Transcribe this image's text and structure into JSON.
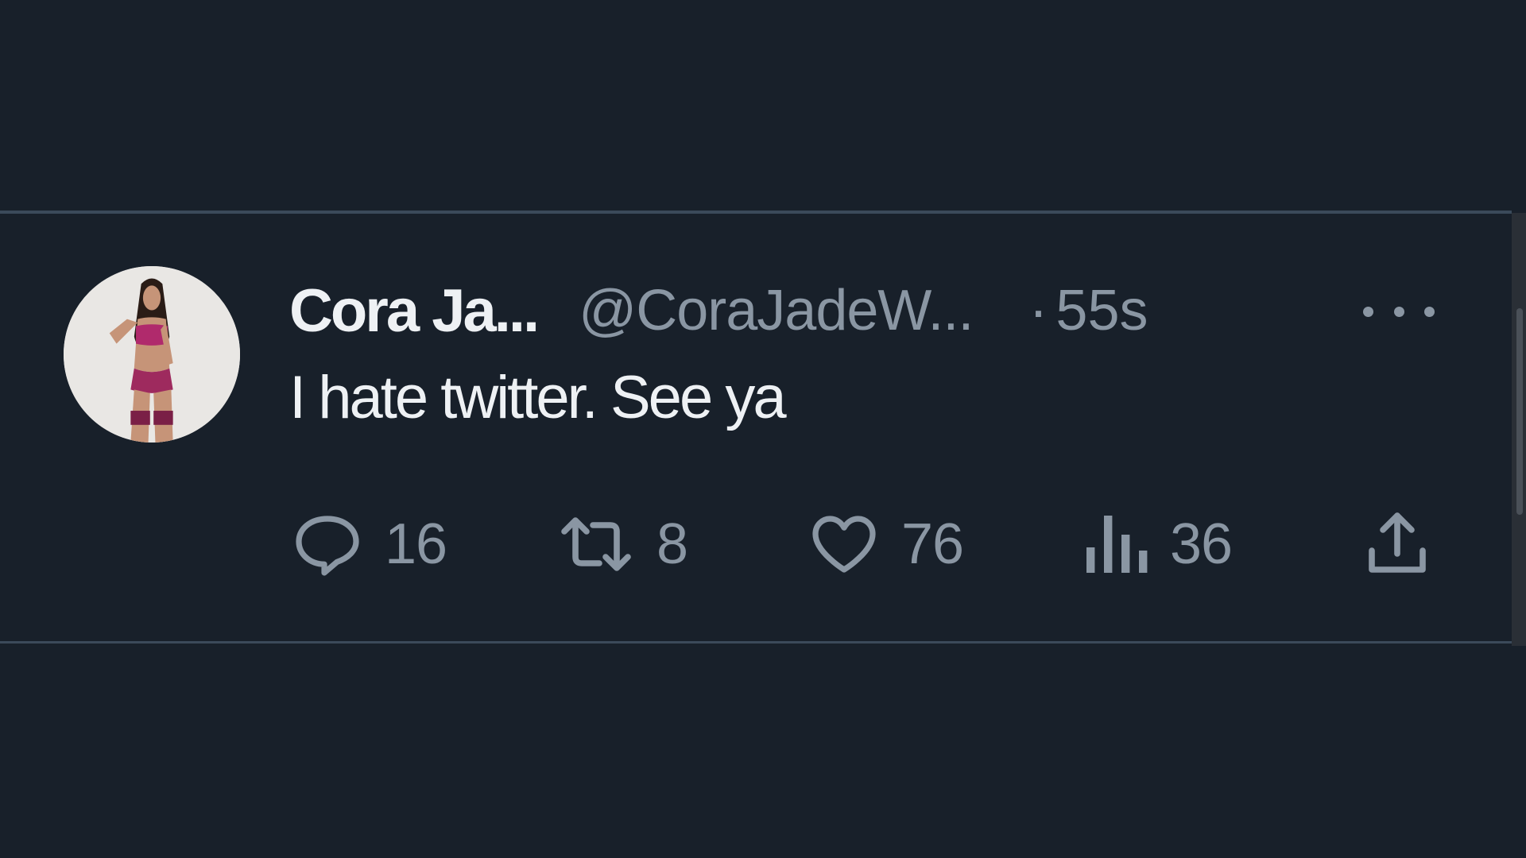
{
  "tweet": {
    "display_name": "Cora Ja...",
    "handle": "@CoraJadeW...",
    "separator": "·",
    "time": "55s",
    "text": "I hate twitter. See ya"
  },
  "actions": {
    "reply_count": "16",
    "retweet_count": "8",
    "like_count": "76",
    "views_count": "36"
  },
  "icons": {
    "more": "more-icon",
    "reply": "reply-icon",
    "retweet": "retweet-icon",
    "like": "heart-icon",
    "views": "views-icon",
    "share": "share-icon"
  },
  "colors": {
    "background": "#18202a",
    "primary_text": "#eef1f4",
    "secondary_text": "#8a96a3",
    "divider": "#3b4a5a"
  }
}
